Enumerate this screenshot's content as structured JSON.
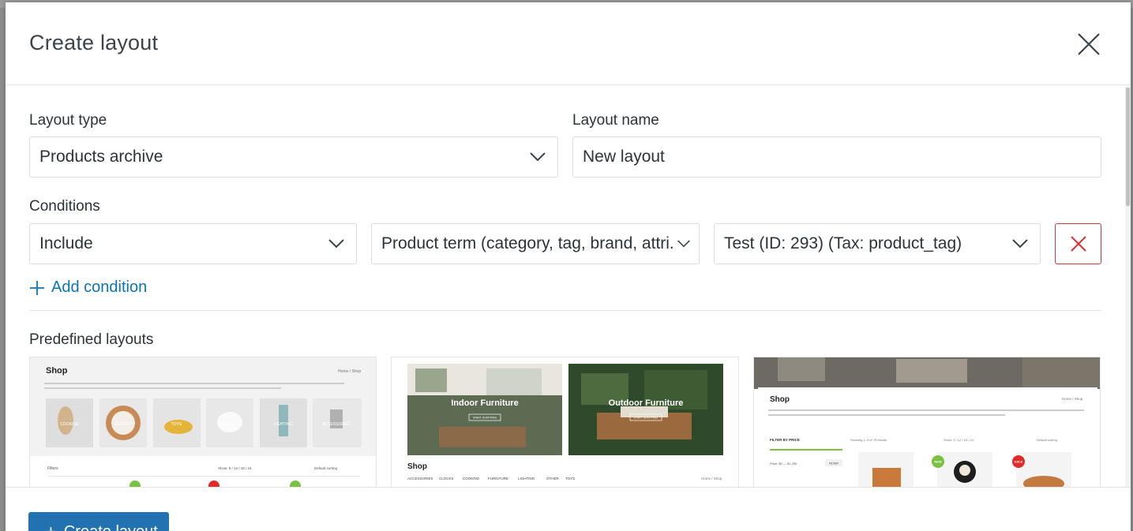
{
  "modal": {
    "title": "Create layout"
  },
  "fields": {
    "layout_type_label": "Layout type",
    "layout_type_value": "Products archive",
    "layout_name_label": "Layout name",
    "layout_name_value": "New layout",
    "conditions_label": "Conditions"
  },
  "condition": {
    "mode": "Include",
    "rule": "Product term (category, tag, brand, attri...",
    "term": "Test (ID: 293) (Tax: product_tag)"
  },
  "add_condition_label": "Add condition",
  "predefined": {
    "label": "Predefined layouts",
    "layouts": [
      {
        "title": "Shop",
        "breadcrumb": "Home / Shop",
        "categories": [
          "COOKING",
          "CLOCKS",
          "TOYS",
          "FURNITURE",
          "LIGHTING",
          "ACCESSORIES"
        ],
        "filter_label": "Filters",
        "sorting": "Default sorting",
        "show_label": "Show: 9 / 12 / 18 / 24"
      },
      {
        "banner_left": "Indoor Furniture",
        "banner_right": "Outdoor Furniture",
        "banner_button": "START SHOPPING",
        "title": "Shop",
        "breadcrumb": "Home / Shop",
        "categories": [
          "ACCESSORIES",
          "CLOCKS",
          "COOKING",
          "FURNITURE",
          "LIGHTING",
          "OTHER",
          "TOYS"
        ]
      },
      {
        "title": "Shop",
        "breadcrumb": "Home / Shop",
        "filter_label": "FILTER BY PRICE",
        "price_range": "Price: $0 — $1,290",
        "filter_button": "FILTER",
        "results": "Showing 1–9 of 79 results",
        "show_label": "Show: 9 / 12 / 18 / 24",
        "sorting": "Default sorting",
        "badge_new": "NEW",
        "badge_sale": "SALE"
      }
    ]
  },
  "footer": {
    "create_label": "Create layout"
  },
  "colors": {
    "accent": "#2271b1",
    "link": "#0a75b5",
    "danger": "#d63638",
    "border": "#dcdcde"
  }
}
